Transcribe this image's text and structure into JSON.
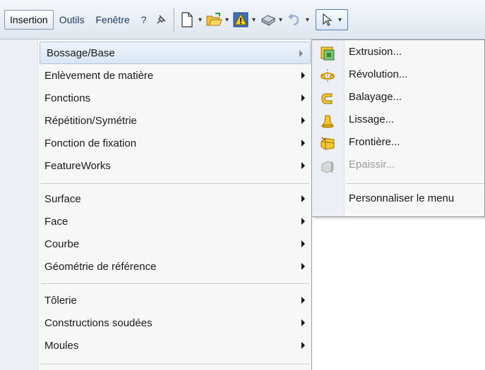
{
  "menubar": {
    "items": [
      {
        "label": "Insertion"
      },
      {
        "label": "Outils"
      },
      {
        "label": "Fenêtre"
      },
      {
        "label": "?"
      }
    ]
  },
  "toolbar": {
    "icons": [
      "pin-icon",
      "new-document-icon",
      "open-folder-icon",
      "rebuild-warning-icon",
      "print-icon",
      "undo-icon",
      "select-cursor-icon"
    ]
  },
  "insert_menu": {
    "groups": [
      [
        "Bossage/Base",
        "Enlèvement de matière",
        "Fonctions",
        "Répétition/Symétrie",
        "Fonction de fixation",
        "FeatureWorks"
      ],
      [
        "Surface",
        "Face",
        "Courbe",
        "Géométrie de référence"
      ],
      [
        "Tôlerie",
        "Constructions soudées",
        "Moules"
      ]
    ],
    "highlighted": "Bossage/Base"
  },
  "submenu": {
    "items": [
      {
        "label": "Extrusion...",
        "icon": "extrude-icon"
      },
      {
        "label": "Révolution...",
        "icon": "revolve-icon"
      },
      {
        "label": "Balayage...",
        "icon": "sweep-icon"
      },
      {
        "label": "Lissage...",
        "icon": "loft-icon"
      },
      {
        "label": "Frontière...",
        "icon": "boundary-icon"
      },
      {
        "label": "Epaissir...",
        "icon": "thicken-icon",
        "disabled": true
      }
    ],
    "customize": "Personnaliser le menu"
  },
  "colors": {
    "accent": "#f5b800",
    "highlight": "#d9e6f4"
  }
}
